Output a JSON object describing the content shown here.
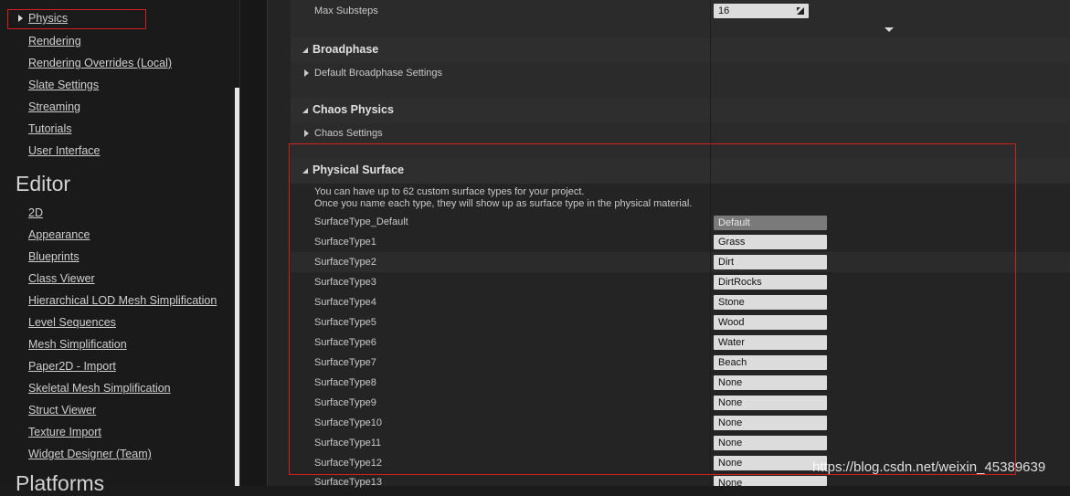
{
  "sidebar": {
    "selected": "Physics",
    "items_top": [
      "Rendering",
      "Rendering Overrides (Local)",
      "Slate Settings",
      "Streaming",
      "Tutorials",
      "User Interface"
    ],
    "section_editor": "Editor",
    "items_editor": [
      "2D",
      "Appearance",
      "Blueprints",
      "Class Viewer",
      "Hierarchical LOD Mesh Simplification",
      "Level Sequences",
      "Mesh Simplification",
      "Paper2D - Import",
      "Skeletal Mesh Simplification",
      "Struct Viewer",
      "Texture Import",
      "Widget Designer (Team)"
    ],
    "section_platforms": "Platforms"
  },
  "main": {
    "max_substeps_label": "Max Substeps",
    "max_substeps_value": "16",
    "broadphase_header": "Broadphase",
    "broadphase_sub": "Default Broadphase Settings",
    "chaos_header": "Chaos Physics",
    "chaos_sub": "Chaos Settings",
    "surface_header": "Physical Surface",
    "surface_note_1": "You can have up to 62 custom surface types for your project.",
    "surface_note_2": "Once you name each type, they will show up as surface type in the physical material.",
    "surface_rows": [
      {
        "label": "SurfaceType_Default",
        "value": "Default"
      },
      {
        "label": "SurfaceType1",
        "value": "Grass"
      },
      {
        "label": "SurfaceType2",
        "value": "Dirt"
      },
      {
        "label": "SurfaceType3",
        "value": "DirtRocks"
      },
      {
        "label": "SurfaceType4",
        "value": "Stone"
      },
      {
        "label": "SurfaceType5",
        "value": "Wood"
      },
      {
        "label": "SurfaceType6",
        "value": "Water"
      },
      {
        "label": "SurfaceType7",
        "value": "Beach"
      },
      {
        "label": "SurfaceType8",
        "value": "None"
      },
      {
        "label": "SurfaceType9",
        "value": "None"
      },
      {
        "label": "SurfaceType10",
        "value": "None"
      },
      {
        "label": "SurfaceType11",
        "value": "None"
      },
      {
        "label": "SurfaceType12",
        "value": "None"
      },
      {
        "label": "SurfaceType13",
        "value": "None"
      }
    ]
  },
  "watermark": "https://blog.csdn.net/weixin_45389639"
}
